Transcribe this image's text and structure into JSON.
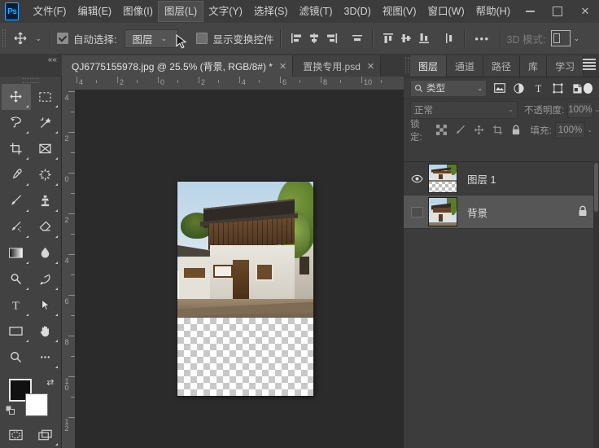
{
  "app": {
    "logo": "Ps",
    "menus": [
      {
        "label": "文件(F)",
        "active": false
      },
      {
        "label": "编辑(E)",
        "active": false
      },
      {
        "label": "图像(I)",
        "active": false
      },
      {
        "label": "图层(L)",
        "active": true
      },
      {
        "label": "文字(Y)",
        "active": false
      },
      {
        "label": "选择(S)",
        "active": false
      },
      {
        "label": "滤镜(T)",
        "active": false
      },
      {
        "label": "3D(D)",
        "active": false
      },
      {
        "label": "视图(V)",
        "active": false
      },
      {
        "label": "窗口(W)",
        "active": false
      },
      {
        "label": "帮助(H)",
        "active": false
      }
    ],
    "window_controls": {
      "minimize": "minimize-icon",
      "maximize": "maximize-icon",
      "close": "✕"
    }
  },
  "options_bar": {
    "tool": "move-tool",
    "auto_select": {
      "label": "自动选择:",
      "checked": true
    },
    "auto_select_scope": "图层",
    "show_transform": {
      "label": "显示变换控件",
      "checked": false
    },
    "align_icons": [
      "align-left-icon",
      "align-center-h-icon",
      "align-right-icon",
      "distribute-h-icon",
      "align-top-icon",
      "align-middle-v-icon",
      "align-bottom-icon",
      "distribute-v-icon"
    ],
    "more_label": "•••",
    "mode_3d_label": "3D 模式:"
  },
  "tabs": {
    "items": [
      {
        "title": "QJ6775155978.jpg @ 25.5% (背景, RGB/8#) *",
        "close": "✕",
        "active": true
      },
      {
        "title": "置换专用.psd",
        "close": "✕",
        "active": false
      }
    ],
    "overflow": "»",
    "collapse": "««"
  },
  "toolbar": {
    "tools": [
      {
        "name": "move-tool",
        "selected": true
      },
      {
        "name": "rectangular-marquee-tool",
        "selected": false
      },
      {
        "name": "lasso-tool",
        "selected": false
      },
      {
        "name": "magic-wand-tool",
        "selected": false
      },
      {
        "name": "crop-tool",
        "selected": false
      },
      {
        "name": "frame-tool",
        "selected": false
      },
      {
        "name": "eyedropper-tool",
        "selected": false
      },
      {
        "name": "spot-healing-brush-tool",
        "selected": false
      },
      {
        "name": "brush-tool",
        "selected": false
      },
      {
        "name": "clone-stamp-tool",
        "selected": false
      },
      {
        "name": "history-brush-tool",
        "selected": false
      },
      {
        "name": "eraser-tool",
        "selected": false
      },
      {
        "name": "gradient-tool",
        "selected": false
      },
      {
        "name": "blur-tool",
        "selected": false
      },
      {
        "name": "dodge-tool",
        "selected": false
      },
      {
        "name": "pen-tool",
        "selected": false
      },
      {
        "name": "type-tool",
        "selected": false
      },
      {
        "name": "path-selection-tool",
        "selected": false
      },
      {
        "name": "rectangle-tool",
        "selected": false
      },
      {
        "name": "hand-tool",
        "selected": false
      },
      {
        "name": "zoom-tool",
        "selected": false
      },
      {
        "name": "edit-toolbar-tool",
        "selected": false
      }
    ],
    "foreground_color": "#111111",
    "background_color": "#ffffff",
    "quick_mask": "quick-mask-icon",
    "screen_mode": "screen-mode-icon"
  },
  "canvas": {
    "ruler_h_labels": [
      "4",
      "2",
      "0",
      "2",
      "4",
      "6",
      "8",
      "10"
    ],
    "ruler_v_labels": [
      "4",
      "2",
      "0",
      "2",
      "4",
      "6",
      "8",
      "10",
      "12"
    ],
    "zoom": "25.5%",
    "background_color": "#2b2b2b"
  },
  "panel": {
    "tabs": [
      {
        "label": "图层",
        "active": true
      },
      {
        "label": "通道",
        "active": false
      },
      {
        "label": "路径",
        "active": false
      },
      {
        "label": "库",
        "active": false
      },
      {
        "label": "学习",
        "active": false
      }
    ],
    "menu_icon": "hamburger-menu-icon",
    "filter": {
      "type_label": "类型",
      "chevron": "⌄",
      "icons": [
        "pixel-filter-icon",
        "adjustment-filter-icon",
        "type-filter-icon",
        "shape-filter-icon",
        "smart-object-filter-icon"
      ],
      "toggle": "filter-toggle-icon"
    },
    "blend": {
      "mode": "正常",
      "chevron": "⌄",
      "opacity_label": "不透明度:",
      "opacity_value": "100%"
    },
    "lock": {
      "label": "锁定:",
      "icons": [
        "lock-transparent-pixels-icon",
        "lock-image-pixels-icon",
        "lock-position-icon",
        "lock-artboard-icon",
        "lock-all-icon"
      ],
      "fill_label": "填充:",
      "fill_value": "100%"
    },
    "layers": [
      {
        "name": "图层 1",
        "visible": true,
        "selected": false,
        "locked": false,
        "thumb_transparent": true
      },
      {
        "name": "背景",
        "visible": false,
        "selected": true,
        "locked": true,
        "thumb_transparent": false
      }
    ]
  },
  "colors": {
    "menu_bar_bg": "#3c3c3c",
    "options_bar_bg": "#454545",
    "panel_bg": "#3c3c3c",
    "canvas_bg": "#2b2b2b",
    "accent_blue": "#31a8ff",
    "selected_layer_bg": "#565656"
  }
}
